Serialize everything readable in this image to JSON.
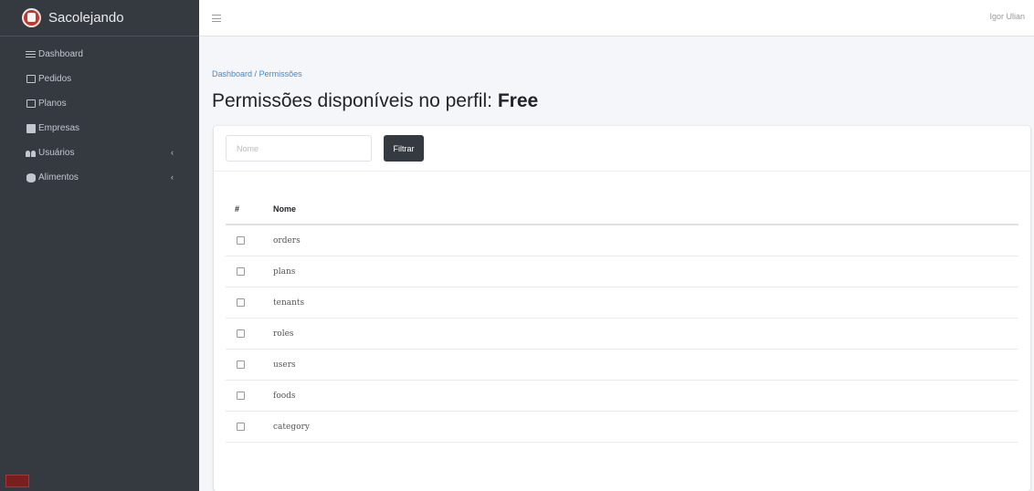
{
  "app": {
    "brand": "Sacolejando"
  },
  "topbar": {
    "user_name": "Igor Ulian"
  },
  "sidebar": {
    "items": [
      {
        "label": "Dashboard",
        "icon": "dashboard-icon",
        "has_submenu": false
      },
      {
        "label": "Pedidos",
        "icon": "clipboard-icon",
        "has_submenu": false
      },
      {
        "label": "Planos",
        "icon": "clipboard-icon",
        "has_submenu": false
      },
      {
        "label": "Empresas",
        "icon": "building-icon",
        "has_submenu": false
      },
      {
        "label": "Usuários",
        "icon": "users-icon",
        "has_submenu": true
      },
      {
        "label": "Alimentos",
        "icon": "database-icon",
        "has_submenu": true
      }
    ]
  },
  "breadcrumb": {
    "home": "Dashboard",
    "separator": "/",
    "current": "Permissões"
  },
  "page": {
    "title_prefix": "Permissões disponíveis no perfil:",
    "profile_name": "Free"
  },
  "filter": {
    "placeholder": "Nome",
    "value": "",
    "button_label": "Filtrar"
  },
  "table": {
    "headers": [
      "#",
      "Nome"
    ],
    "rows": [
      {
        "name": "orders",
        "checked": false
      },
      {
        "name": "plans",
        "checked": false
      },
      {
        "name": "tenants",
        "checked": false
      },
      {
        "name": "roles",
        "checked": false
      },
      {
        "name": "users",
        "checked": false
      },
      {
        "name": "foods",
        "checked": false
      },
      {
        "name": "category",
        "checked": false
      }
    ]
  },
  "colors": {
    "sidebar_bg": "#343a40",
    "content_bg": "#f4f6f9",
    "link": "#3d8bd6",
    "button_bg": "#343a40"
  }
}
